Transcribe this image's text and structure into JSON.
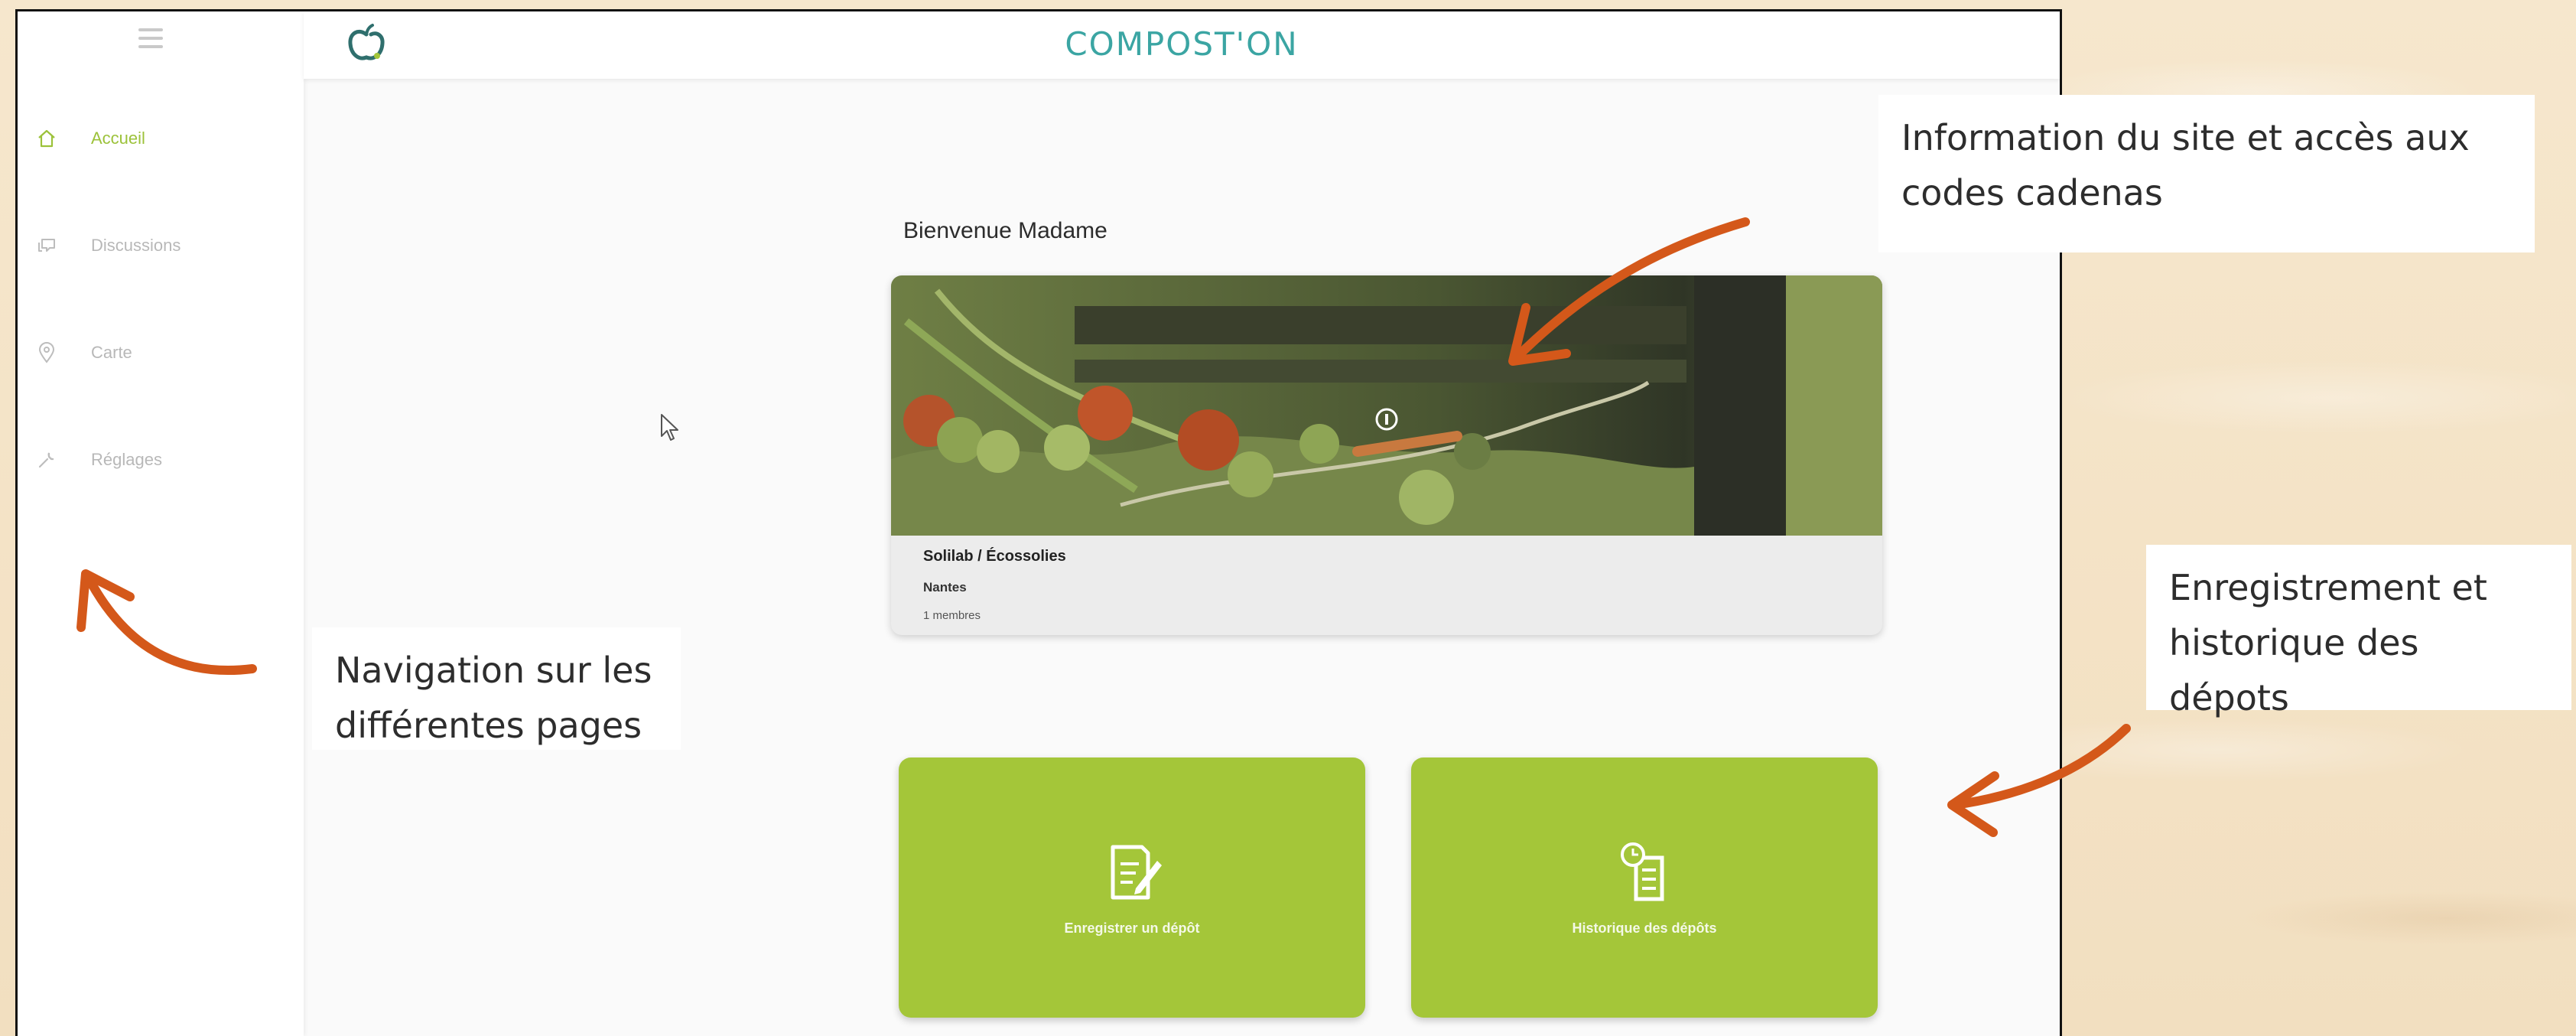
{
  "app": {
    "brand": "COMPOST'ON",
    "logo_icon": "apple-compost-icon",
    "accent_color": "#a4c639",
    "brand_color": "#3ba5a3"
  },
  "sidebar": {
    "menu_icon": "hamburger-menu-icon",
    "items": [
      {
        "label": "Accueil",
        "icon": "home-icon",
        "active": true
      },
      {
        "label": "Discussions",
        "icon": "chat-icon",
        "active": false
      },
      {
        "label": "Carte",
        "icon": "map-pin-icon",
        "active": false
      },
      {
        "label": "Réglages",
        "icon": "wrench-icon",
        "active": false
      }
    ]
  },
  "main": {
    "welcome": "Bienvenue Madame",
    "site_card": {
      "name": "Solilab / Écossolies",
      "city": "Nantes",
      "members": "1 membres",
      "info_icon": "info-icon"
    },
    "actions": [
      {
        "label": "Enregistrer un dépôt",
        "icon": "edit-document-icon"
      },
      {
        "label": "Historique des dépôts",
        "icon": "history-document-icon"
      }
    ]
  },
  "annotations": {
    "site_info": "Information du site et accès aux codes cadenas",
    "site_info_line1": "Information du site et accès aux",
    "site_info_line2": "codes cadenas",
    "deposits_line1": "Enregistrement et",
    "deposits_line2": "historique des dépots",
    "navigation_line1": "Navigation sur les",
    "navigation_line2": "différentes pages",
    "arrow_color": "#d4581a"
  }
}
